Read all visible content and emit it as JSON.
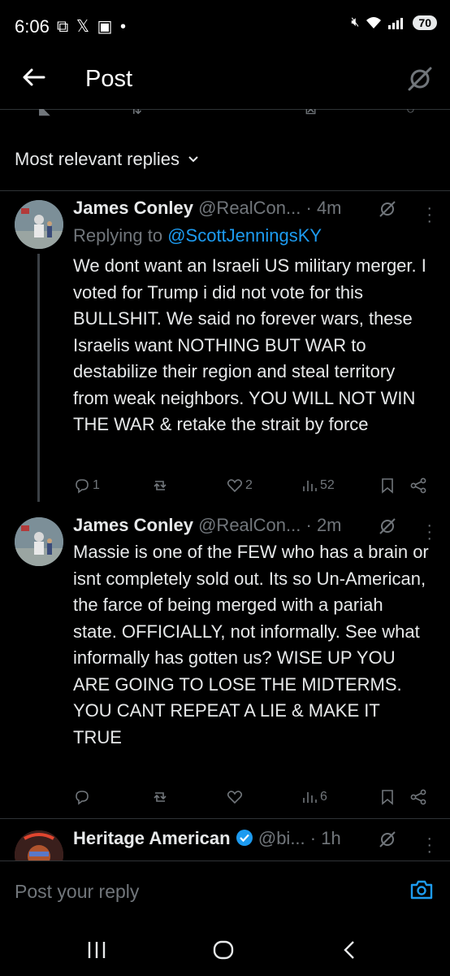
{
  "status_bar": {
    "time": "6:06",
    "left_icons": [
      "screenshot-icon",
      "x-logo-icon",
      "notification-icon",
      "dot-icon"
    ],
    "right_icons": [
      "mute-icon",
      "wifi-icon",
      "signal-icon"
    ],
    "battery": "70"
  },
  "header": {
    "title": "Post"
  },
  "sort": {
    "label": "Most relevant replies"
  },
  "replies": [
    {
      "name": "James Conley",
      "handle": "@RealCon...",
      "time": "· 4m",
      "reply_label": "Replying to",
      "reply_to": "@ScottJenningsKY",
      "body": "We dont want an Israeli US military merger. I voted for Trump i did not vote for this BULLSHIT. We said no forever wars, these Israelis want NOTHING BUT WAR to destabilize their region and steal territory from weak neighbors. YOU WILL NOT WIN THE WAR  & retake the strait by force",
      "replies": "1",
      "reposts": "",
      "likes": "2",
      "views": "52"
    },
    {
      "name": "James Conley",
      "handle": "@RealCon...",
      "time": "· 2m",
      "body": "Massie is one of the FEW who has a brain or isnt completely sold out. Its so Un-American, the farce of being merged with a pariah state. OFFICIALLY, not informally. See what informally has gotten us? WISE UP YOU ARE GOING TO LOSE THE MIDTERMS. YOU CANT REPEAT A LIE & MAKE IT TRUE",
      "replies": "",
      "reposts": "",
      "likes": "",
      "views": "6"
    },
    {
      "name": "Heritage American",
      "handle": "@bi...",
      "time": "· 1h",
      "verified": true
    }
  ],
  "composer": {
    "placeholder": "Post your reply"
  },
  "colors": {
    "accent": "#1d9bf0",
    "muted": "#71767b",
    "background": "#000000",
    "text": "#e7e9ea"
  }
}
